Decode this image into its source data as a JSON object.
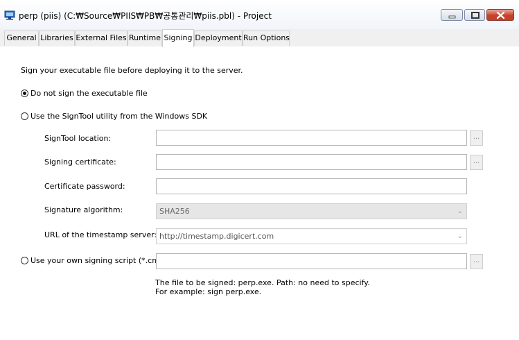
{
  "window": {
    "title": "perp (piis) (C:₩Source₩PIIS₩PB₩공통관리₩piis.pbl) - Project",
    "icon": "project-icon",
    "controls": {
      "minimize": "minimize-icon",
      "maximize": "maximize-icon",
      "close": "close-icon"
    }
  },
  "tabs": [
    {
      "label": "General"
    },
    {
      "label": "Libraries"
    },
    {
      "label": "External Files"
    },
    {
      "label": "Runtime"
    },
    {
      "label": "Signing",
      "active": true
    },
    {
      "label": "Deployment"
    },
    {
      "label": "Run Options"
    }
  ],
  "signing": {
    "intro": "Sign your executable file before deploying it to the server.",
    "option_none": {
      "label": "Do not sign the executable file",
      "selected": true
    },
    "option_signtool": {
      "label": "Use the SignTool utility from the Windows SDK",
      "selected": false
    },
    "signtool_location": {
      "label": "SignTool location:",
      "value": ""
    },
    "signing_certificate": {
      "label": "Signing certificate:",
      "value": ""
    },
    "certificate_password": {
      "label": "Certificate password:",
      "value": ""
    },
    "signature_algorithm": {
      "label": "Signature algorithm:",
      "value": "SHA256"
    },
    "timestamp_url": {
      "label": "URL of the timestamp server:",
      "value": "http://timestamp.digicert.com"
    },
    "option_script": {
      "label": "Use your own signing script (*.cmd)",
      "selected": false,
      "value": ""
    },
    "browse_label": "...",
    "note_line1": "The file to be signed: perp.exe. Path: no need to specify.",
    "note_line2": "For example: sign perp.exe."
  }
}
